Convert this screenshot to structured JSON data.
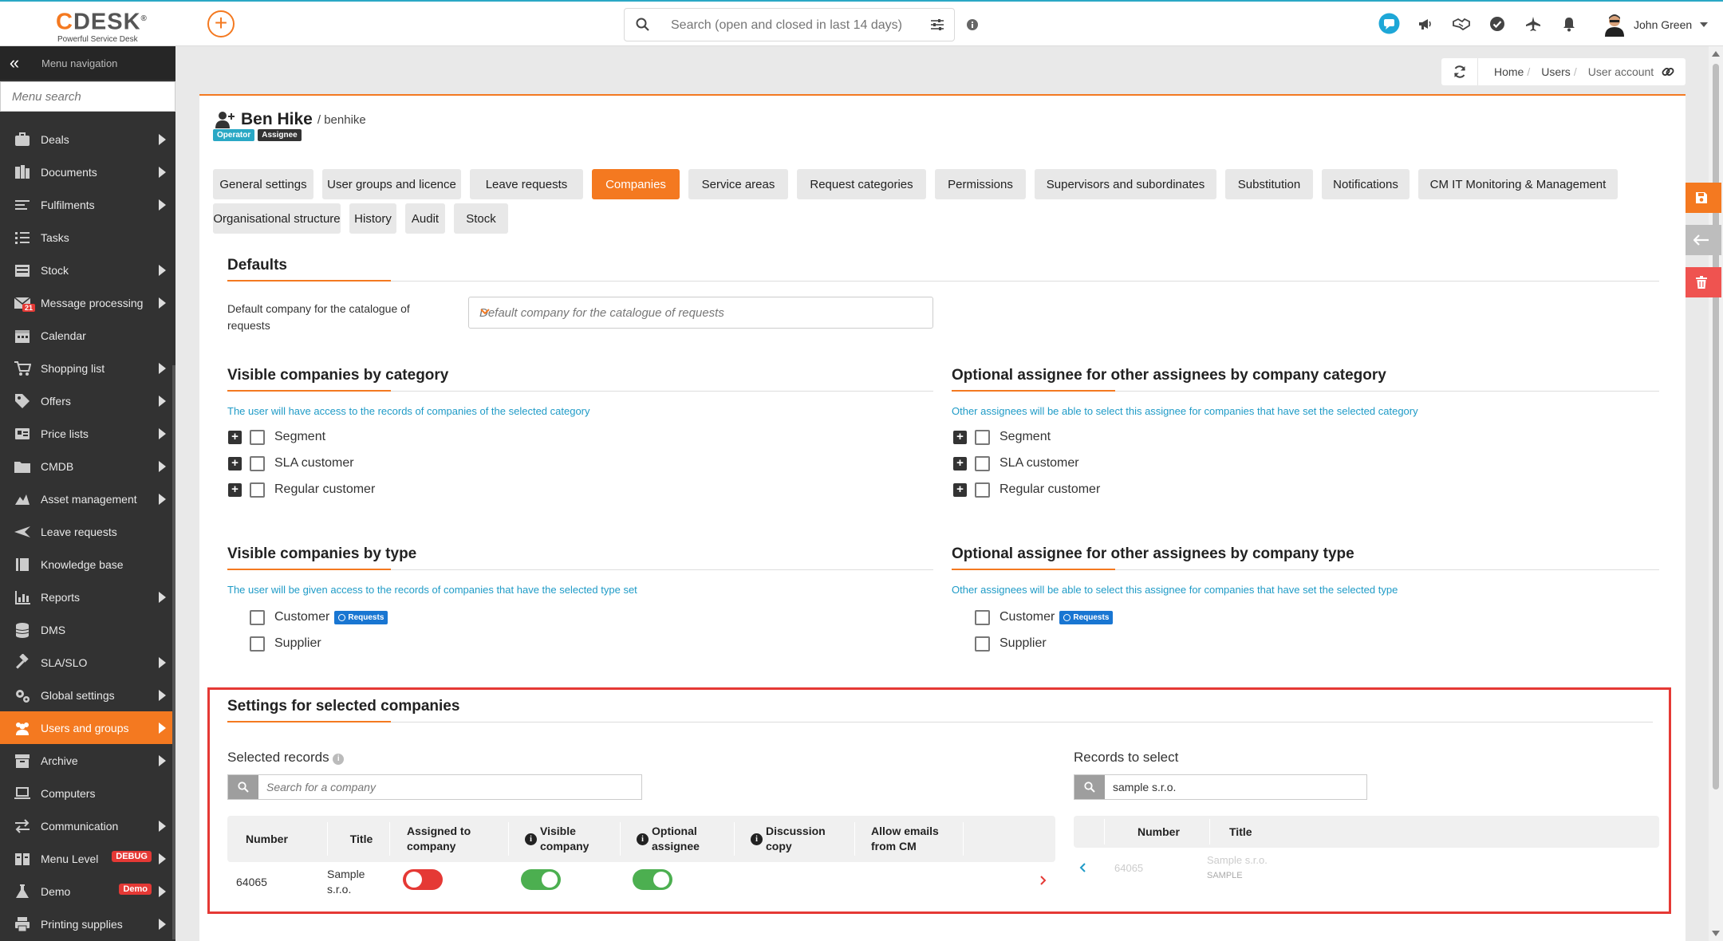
{
  "header": {
    "logo_brand": "DESK",
    "logo_c": "C",
    "logo_tagline": "Powerful Service Desk",
    "search_placeholder": "Search (open and closed in last 14 days)",
    "user_name": "John Green"
  },
  "sidebar": {
    "title": "Menu navigation",
    "search_placeholder": "Menu search",
    "items": [
      {
        "label": "Deals",
        "icon": "briefcase-icon",
        "arrow": true
      },
      {
        "label": "Documents",
        "icon": "documents-icon",
        "arrow": true
      },
      {
        "label": "Fulfilments",
        "icon": "list-icon",
        "arrow": true
      },
      {
        "label": "Tasks",
        "icon": "tasks-icon",
        "arrow": false
      },
      {
        "label": "Stock",
        "icon": "stock-icon",
        "arrow": true
      },
      {
        "label": "Message processing",
        "icon": "envelope-icon",
        "arrow": true,
        "count": "21"
      },
      {
        "label": "Calendar",
        "icon": "calendar-icon",
        "arrow": false
      },
      {
        "label": "Shopping list",
        "icon": "cart-icon",
        "arrow": true
      },
      {
        "label": "Offers",
        "icon": "tag-icon",
        "arrow": true
      },
      {
        "label": "Price lists",
        "icon": "price-list-icon",
        "arrow": true
      },
      {
        "label": "CMDB",
        "icon": "folder-icon",
        "arrow": true
      },
      {
        "label": "Asset management",
        "icon": "asset-icon",
        "arrow": true
      },
      {
        "label": "Leave requests",
        "icon": "plane-icon",
        "arrow": false
      },
      {
        "label": "Knowledge base",
        "icon": "book-icon",
        "arrow": false
      },
      {
        "label": "Reports",
        "icon": "chart-icon",
        "arrow": true
      },
      {
        "label": "DMS",
        "icon": "database-icon",
        "arrow": false
      },
      {
        "label": "SLA/SLO",
        "icon": "gavel-icon",
        "arrow": true
      },
      {
        "label": "Global settings",
        "icon": "gears-icon",
        "arrow": true
      },
      {
        "label": "Users and groups",
        "icon": "users-icon",
        "arrow": true,
        "active": true
      },
      {
        "label": "Archive",
        "icon": "archive-icon",
        "arrow": true
      },
      {
        "label": "Computers",
        "icon": "laptop-icon",
        "arrow": false
      },
      {
        "label": "Communication",
        "icon": "exchange-icon",
        "arrow": true
      },
      {
        "label": "Menu Level",
        "icon": "columns-icon",
        "arrow": true,
        "badge": "DEBUG"
      },
      {
        "label": "Demo",
        "icon": "flask-icon",
        "arrow": true,
        "badge": "Demo"
      },
      {
        "label": "Printing supplies",
        "icon": "printer-icon",
        "arrow": true
      }
    ]
  },
  "breadcrumb": {
    "home": "Home",
    "users": "Users",
    "current": "User account"
  },
  "user": {
    "name": "Ben Hike",
    "login": "/ benhike",
    "badge_operator": "Operator",
    "badge_assignee": "Assignee"
  },
  "tabs": [
    "General settings",
    "User groups and licence",
    "Leave requests",
    "Companies",
    "Service areas",
    "Request categories",
    "Permissions",
    "Supervisors and subordinates",
    "Substitution",
    "Notifications",
    "CM IT Monitoring & Management",
    "Organisational structure",
    "History",
    "Audit",
    "Stock"
  ],
  "active_tab": "Companies",
  "defaults": {
    "title": "Defaults",
    "label_line1": "Default company for the catalogue of",
    "label_line2": "requests",
    "placeholder": "Default company for the catalogue of requests"
  },
  "visible_by_category": {
    "title": "Visible companies by category",
    "desc": "The user will have access to the records of companies of the selected category",
    "items": [
      "Segment",
      "SLA customer",
      "Regular customer"
    ]
  },
  "optional_by_category": {
    "title": "Optional assignee for other assignees by company category",
    "desc": "Other assignees will be able to select this assignee for companies that have set the selected category",
    "items": [
      "Segment",
      "SLA customer",
      "Regular customer"
    ]
  },
  "visible_by_type": {
    "title": "Visible companies by type",
    "desc": "The user will be given access to the records of companies that have the selected type set",
    "items": [
      "Customer",
      "Supplier"
    ],
    "requests_badge": "Requests"
  },
  "optional_by_type": {
    "title": "Optional assignee for other assignees by company type",
    "desc": "Other assignees will be able to select this assignee for companies that have set the selected type",
    "items": [
      "Customer",
      "Supplier"
    ],
    "requests_badge": "Requests"
  },
  "settings": {
    "title": "Settings for selected companies",
    "selected_title": "Selected records",
    "selected_search_placeholder": "Search for a company",
    "columns": {
      "number": "Number",
      "title": "Title",
      "assigned_l1": "Assigned to",
      "assigned_l2": "company",
      "visible_l1": "Visible",
      "visible_l2": "company",
      "optional_l1": "Optional",
      "optional_l2": "assignee",
      "discussion_l1": "Discussion",
      "discussion_l2": "copy",
      "emails_l1": "Allow emails",
      "emails_l2": "from CM"
    },
    "row": {
      "number": "64065",
      "title_l1": "Sample",
      "title_l2": "s.r.o.",
      "assigned": false,
      "visible": true,
      "optional": true
    },
    "records_title": "Records to select",
    "records_search_value": "sample s.r.o.",
    "records_columns": {
      "number": "Number",
      "title": "Title"
    },
    "records_row": {
      "number": "64065",
      "title": "Sample s.r.o.",
      "code": "SAMPLE"
    }
  },
  "colors": {
    "accent": "#f47920",
    "sidebar": "#323232",
    "link": "#1f9bc7",
    "danger": "#e53935",
    "success": "#4caf50"
  }
}
